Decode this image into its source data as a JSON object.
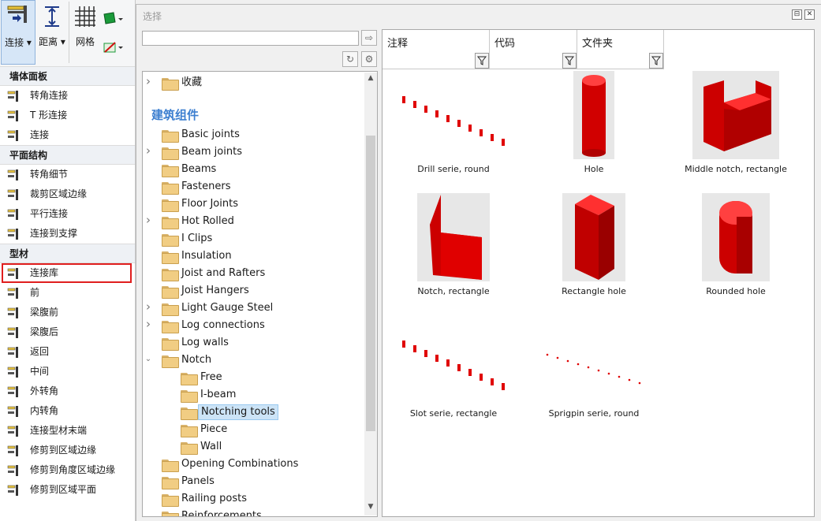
{
  "ribbon": {
    "connect_label": "连接 ▾",
    "distance_label": "距离 ▾",
    "grid_label": "网格"
  },
  "left_panel": {
    "sections": [
      {
        "title": "墙体面板",
        "items": [
          {
            "label": "转角连接",
            "icon": "corner-joint-icon"
          },
          {
            "label": "T 形连接",
            "icon": "t-joint-icon"
          },
          {
            "label": "连接",
            "icon": "connect-icon"
          }
        ]
      },
      {
        "title": "平面结构",
        "items": [
          {
            "label": "转角细节",
            "icon": "corner-detail-icon"
          },
          {
            "label": "裁剪区域边缘",
            "icon": "trim-region-edge-icon"
          },
          {
            "label": "平行连接",
            "icon": "parallel-joint-icon"
          },
          {
            "label": "连接到支撑",
            "icon": "connect-support-icon"
          }
        ]
      },
      {
        "title": "型材",
        "items": [
          {
            "label": "连接库",
            "icon": "joint-library-icon",
            "selected": true
          },
          {
            "label": "前",
            "icon": "front-icon"
          },
          {
            "label": "梁腹前",
            "icon": "web-front-icon"
          },
          {
            "label": "梁腹后",
            "icon": "web-back-icon"
          },
          {
            "label": "返回",
            "icon": "return-icon"
          },
          {
            "label": "中间",
            "icon": "middle-icon"
          },
          {
            "label": "外转角",
            "icon": "outer-corner-icon"
          },
          {
            "label": "内转角",
            "icon": "inner-corner-icon"
          },
          {
            "label": "连接型材末端",
            "icon": "profile-end-icon"
          },
          {
            "label": "修剪到区域边缘",
            "icon": "trim-edge-icon"
          },
          {
            "label": "修剪到角度区域边缘",
            "icon": "trim-angle-edge-icon"
          },
          {
            "label": "修剪到区域平面",
            "icon": "trim-plane-icon"
          }
        ]
      }
    ]
  },
  "dialog": {
    "title": "选择",
    "search_value": "",
    "tree": {
      "favorites": "收藏",
      "category": "建筑组件",
      "top_nodes": [
        {
          "label": "Basic joints",
          "expandable": false
        },
        {
          "label": "Beam joints",
          "expandable": true
        },
        {
          "label": "Beams",
          "expandable": false
        },
        {
          "label": "Fasteners",
          "expandable": false
        },
        {
          "label": "Floor Joints",
          "expandable": false
        },
        {
          "label": "Hot Rolled",
          "expandable": true
        },
        {
          "label": "I Clips",
          "expandable": false
        },
        {
          "label": "Insulation",
          "expandable": false
        },
        {
          "label": "Joist and Rafters",
          "expandable": false
        },
        {
          "label": "Joist Hangers",
          "expandable": false
        },
        {
          "label": "Light Gauge Steel",
          "expandable": true
        },
        {
          "label": "Log connections",
          "expandable": true
        },
        {
          "label": "Log walls",
          "expandable": false
        },
        {
          "label": "Notch",
          "expandable": true,
          "expanded": true
        }
      ],
      "notch_children": [
        {
          "label": "Free"
        },
        {
          "label": "I-beam"
        },
        {
          "label": "Notching tools",
          "selected": true
        },
        {
          "label": "Piece"
        },
        {
          "label": "Wall"
        }
      ],
      "bottom_nodes": [
        {
          "label": "Opening Combinations"
        },
        {
          "label": "Panels"
        },
        {
          "label": "Railing posts"
        },
        {
          "label": "Reinforcements"
        }
      ]
    },
    "columns": [
      "注释",
      "代码",
      "文件夹"
    ],
    "tiles": [
      {
        "caption": "Drill serie, round",
        "kind": "dots"
      },
      {
        "caption": "Hole",
        "kind": "cylinder"
      },
      {
        "caption": "Middle notch, rectangle",
        "kind": "notchbox"
      },
      {
        "caption": "Notch, rectangle",
        "kind": "notch"
      },
      {
        "caption": "Rectangle hole",
        "kind": "rectbox"
      },
      {
        "caption": "Rounded hole",
        "kind": "roundbox"
      },
      {
        "caption": "Slot serie, rectangle",
        "kind": "dots"
      },
      {
        "caption": "Sprigpin serie, round",
        "kind": "pins"
      }
    ],
    "colors": {
      "accent_red": "#e00000",
      "highlight": "#cce4f7",
      "category_blue": "#3d7fd0"
    }
  }
}
